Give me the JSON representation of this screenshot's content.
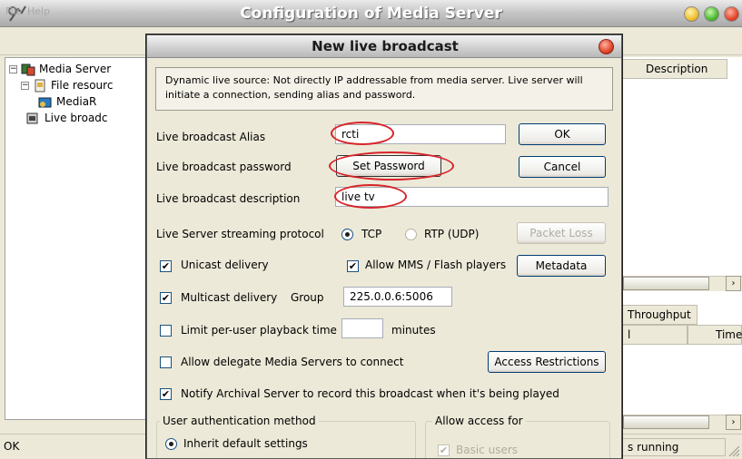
{
  "main": {
    "title": "Configuration of Media Server",
    "menu": [
      "File",
      "Help"
    ],
    "tree": [
      {
        "label": "Media Server"
      },
      {
        "label": "File resourc"
      },
      {
        "label": "MediaR"
      },
      {
        "label": "Live broadc"
      }
    ],
    "columns": {
      "description": "Description",
      "throughput": "Throughput",
      "col_l": "l",
      "time": "Time"
    },
    "status_left": "OK",
    "status_right": "s running"
  },
  "dialog": {
    "title": "New live broadcast",
    "info": "Dynamic live source: Not directly IP addressable from media server. Live server will initiate a connection, sending alias and password.",
    "alias": {
      "label": "Live broadcast Alias",
      "value": "rcti"
    },
    "password": {
      "label": "Live broadcast password",
      "button": "Set Password"
    },
    "description": {
      "label": "Live broadcast description",
      "value": "live tv"
    },
    "protocol": {
      "label": "Live Server streaming protocol",
      "options": [
        "TCP",
        "RTP (UDP)"
      ],
      "selected": "TCP"
    },
    "buttons": {
      "ok": "OK",
      "cancel": "Cancel",
      "packet_loss": "Packet Loss",
      "metadata": "Metadata",
      "access": "Access Restrictions"
    },
    "unicast": {
      "label": "Unicast delivery",
      "checked": true
    },
    "allow_mms": {
      "label": "Allow MMS / Flash players",
      "checked": true
    },
    "multicast": {
      "label": "Multicast delivery",
      "checked": true,
      "group_label": "Group",
      "group_value": "225.0.0.6:5006"
    },
    "limit": {
      "label": "Limit per-user playback time",
      "checked": false,
      "unit": "minutes",
      "value": ""
    },
    "delegate": {
      "label": "Allow delegate Media Servers to connect",
      "checked": false
    },
    "notify": {
      "label": "Notify Archival Server to record this broadcast when it's being played",
      "checked": true
    },
    "auth_group": {
      "title": "User authentication method",
      "option": "Inherit default settings",
      "selected": true
    },
    "access_group": {
      "title": "Allow access for",
      "option": "Basic users",
      "checked": true
    }
  }
}
